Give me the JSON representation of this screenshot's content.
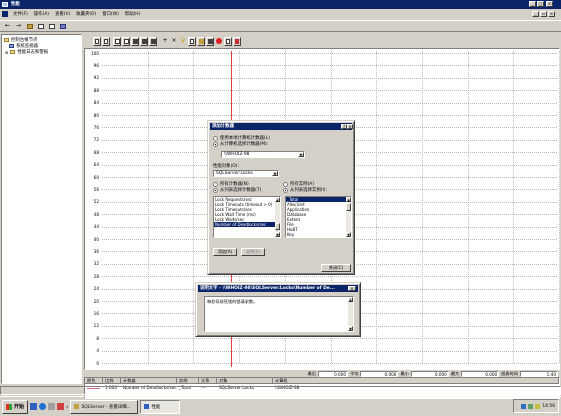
{
  "window": {
    "title": "性能"
  },
  "menu": [
    "文件(F)",
    "操作(A)",
    "查看(V)",
    "收藏夹(O)",
    "窗口(W)",
    "帮助(H)"
  ],
  "tree": {
    "root": "控制台根节点",
    "child1": "系统监视器",
    "child2": "性能日志和警报"
  },
  "graph": {
    "y_ticks": [
      "100",
      "96",
      "92",
      "88",
      "84",
      "80",
      "76",
      "72",
      "68",
      "64",
      "60",
      "56",
      "52",
      "48",
      "44",
      "40",
      "36",
      "32",
      "28",
      "24",
      "20",
      "16",
      "12",
      "8",
      "4",
      "0"
    ],
    "cursor_color": "#e04040"
  },
  "stats": {
    "last_label": "最后",
    "last_value": "0.000",
    "avg_label": "平均",
    "avg_value": "0.000",
    "min_label": "最小",
    "min_value": "0.000",
    "max_label": "最大",
    "max_value": "0.000",
    "duration_label": "图表时间",
    "duration_value": "1:40"
  },
  "legend": {
    "headers": [
      "颜色",
      "比例",
      "计数器",
      "实例",
      "父系",
      "对象",
      "计算机"
    ],
    "rows": [
      {
        "color": "#d060a0",
        "scale": "1.000",
        "counter": "Number of Deadlocks/sec",
        "instance": "_Total",
        "parent": "---",
        "object": "SQLServer:Locks",
        "computer": "\\\\WHOIZ-98"
      }
    ]
  },
  "add_counter_dialog": {
    "title": "添加计数器",
    "help": "?",
    "close": "×",
    "radio_local": "使用本地计算机计数器(L)",
    "radio_select": "从计算机选择计数器(M):",
    "computer_value": "\\\\WHOIZ-98",
    "object_label": "性能对象(O):",
    "object_value": "SQLServer:Locks",
    "all_counters": "所有计数器(N)",
    "select_counters": "从列表选择计数器(T)",
    "all_instances": "所有实例(A)",
    "select_instances": "从列表选择实例(I):",
    "counters": [
      "Lock Requests/sec",
      "Lock Timeouts (timeout > 0)",
      "Lock Timeouts/sec",
      "Lock Wait Time (ms)",
      "Lock Waits/sec",
      "Number of Deadlocks/sec"
    ],
    "instances": [
      "_Total",
      "AllocUnit",
      "Application",
      "Database",
      "Extent",
      "File",
      "HoBT",
      "Key"
    ],
    "add_button": "添加(A)",
    "explain_button": "说明(E)",
    "close_button": "关闭(C)"
  },
  "explain_dialog": {
    "title": "说明文字 - \\\\WHOIZ-98\\SQLServer:Locks\\Number of De...",
    "text": "每秒导致死锁的锁请求数。"
  },
  "taskbar": {
    "start": "开始",
    "task1": "SQLServer - 查看详细...",
    "task2": "性能"
  },
  "tray": {
    "time": "14:56"
  },
  "icons": [
    "computer-icon",
    "monitor-icon",
    "log-icon",
    "back-icon",
    "forward-icon",
    "up-icon",
    "help-icon",
    "delete-icon",
    "add-icon",
    "highlight-icon",
    "copy-icon",
    "paste-icon",
    "properties-icon",
    "freeze-icon",
    "clear-icon",
    "new-counter-set-icon",
    "chart-icon",
    "histogram-icon",
    "report-icon",
    "update-icon",
    "start-icon",
    "network-icon",
    "volume-icon"
  ]
}
